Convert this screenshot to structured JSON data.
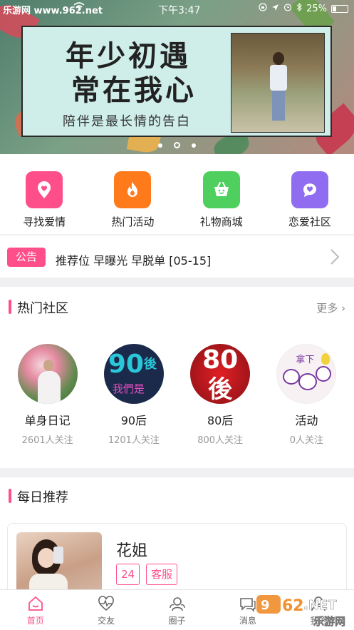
{
  "status_bar": {
    "carrier": "乐游网 www.962.net",
    "time": "下午3:47",
    "battery": "25%"
  },
  "banner": {
    "title_line1": "年少初遇",
    "title_line2": "常在我心",
    "subtitle": "陪伴是最长情的告白",
    "page_count": 3,
    "active_index": 1
  },
  "quick_actions": [
    {
      "label": "寻找爱情",
      "icon": "heart-pin-icon",
      "color": "#ff4f8a"
    },
    {
      "label": "热门活动",
      "icon": "fire-icon",
      "color": "#ff7a1a"
    },
    {
      "label": "礼物商城",
      "icon": "basket-icon",
      "color": "#4fcf5e"
    },
    {
      "label": "恋爱社区",
      "icon": "chat-heart-icon",
      "color": "#8f6cf0"
    }
  ],
  "notice": {
    "badge": "公告",
    "text": "推荐位 早曝光 早脱单 [05-15]"
  },
  "hot_community": {
    "title": "热门社区",
    "more": "更多 ›",
    "items": [
      {
        "name": "单身日记",
        "followers": "2601人关注",
        "avatar": "flower-girl-avatar"
      },
      {
        "name": "90后",
        "followers": "1201人关注",
        "avatar": "90-avatar",
        "badge_text1": "90",
        "badge_text2": "後",
        "badge_text3": "我們是"
      },
      {
        "name": "80后",
        "followers": "800人关注",
        "avatar": "80-avatar",
        "badge_text1": "80",
        "badge_text2": "後"
      },
      {
        "name": "活动",
        "followers": "0人关注",
        "avatar": "cartoon-avatar",
        "badge_text1": "拿下"
      }
    ]
  },
  "daily": {
    "title": "每日推荐",
    "card": {
      "name": "花姐",
      "tags": [
        "24",
        "客服"
      ]
    }
  },
  "tabbar": {
    "tabs": [
      {
        "label": "首页",
        "icon": "home-icon",
        "active": true
      },
      {
        "label": "交友",
        "icon": "heartbeat-icon",
        "active": false
      },
      {
        "label": "圈子",
        "icon": "group-icon",
        "active": false
      },
      {
        "label": "消息",
        "icon": "message-icon",
        "active": false
      },
      {
        "label": "我的",
        "icon": "profile-icon",
        "active": false
      }
    ]
  },
  "watermark": "962.NET 乐游网",
  "colors": {
    "accent": "#ff4f8a"
  }
}
